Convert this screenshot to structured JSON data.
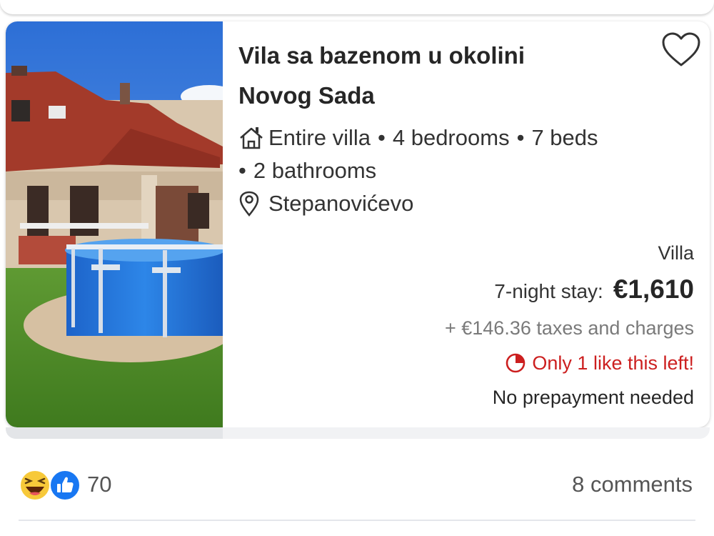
{
  "listing": {
    "title_line1": "Vila sa bazenom u okolini",
    "title_line2": "Novog Sada",
    "property_kind": "Entire villa",
    "bedrooms": "4 bedrooms",
    "beds": "7 beds",
    "bathrooms": "2 bathrooms",
    "location": "Stepanovićevo",
    "save_icon": "heart-outline-icon"
  },
  "pricing": {
    "type_label": "Villa",
    "stay_label": "7-night stay:",
    "price": "€1,610",
    "taxes": "+ €146.36 taxes and charges",
    "scarcity": "Only 1 like this left!",
    "prepayment": "No prepayment needed",
    "scarcity_color": "#cc1f1f"
  },
  "social": {
    "reaction_count": "70",
    "comments": "8 comments",
    "reaction_icons": [
      "haha-emoji-icon",
      "like-thumb-icon"
    ]
  }
}
